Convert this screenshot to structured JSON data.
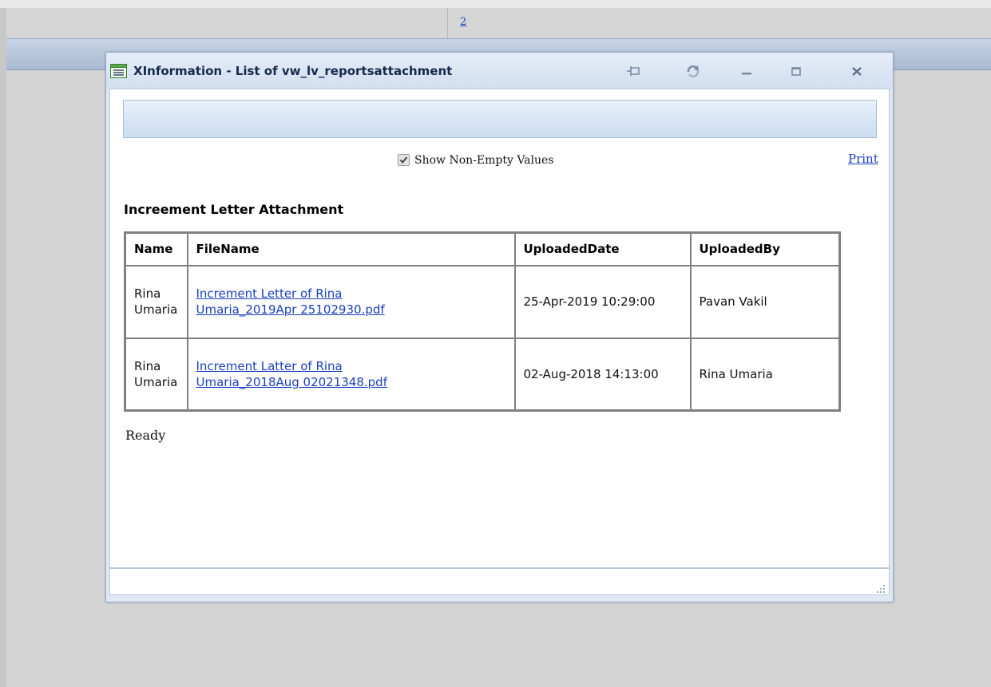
{
  "background": {
    "page_link": "2"
  },
  "dialog": {
    "title": "XInformation - List of vw_lv_reportsattachment",
    "icons": {
      "window": "list-window-icon",
      "pin": "pin-icon",
      "refresh": "refresh-icon",
      "minimize": "minimize-icon",
      "maximize": "maximize-icon",
      "close": "close-icon",
      "resize": "resize-grip-icon"
    }
  },
  "options": {
    "show_non_empty_label": "Show Non-Empty Values",
    "show_non_empty_checked": true,
    "print_label": "Print"
  },
  "section": {
    "title": "Increement Letter Attachment"
  },
  "table": {
    "headers": [
      "Name",
      "FileName",
      "UploadedDate",
      "UploadedBy"
    ],
    "rows": [
      {
        "name": "Rina Umaria",
        "file": "Increment Letter of Rina Umaria_2019Apr 25102930.pdf",
        "date": "25-Apr-2019 10:29:00",
        "by": "Pavan Vakil"
      },
      {
        "name": "Rina Umaria",
        "file": "Increment Latter of Rina Umaria_2018Aug 02021348.pdf",
        "date": "02-Aug-2018 14:13:00",
        "by": "Rina Umaria"
      }
    ]
  },
  "status": {
    "text": "Ready"
  },
  "colors": {
    "link": "#1a3fbf",
    "title_text": "#15294a",
    "table_border": "#808080",
    "window_chrome": "#dfe8f5"
  }
}
